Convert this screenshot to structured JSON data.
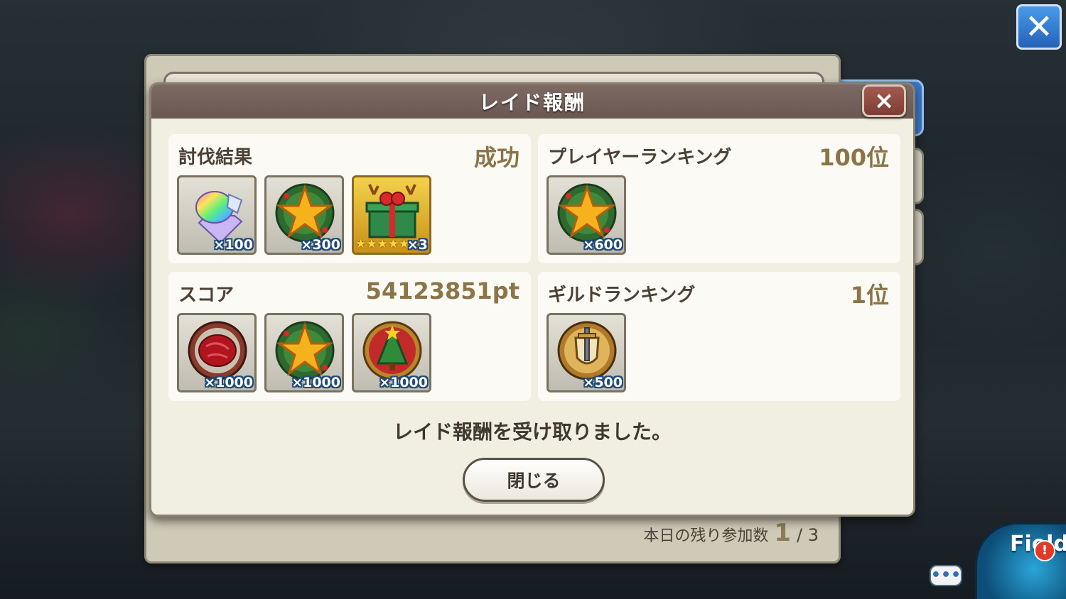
{
  "dialog": {
    "title": "レイド報酬",
    "close_icon": "×",
    "message": "レイド報酬を受け取りました。",
    "close_label": "閉じる"
  },
  "sections": {
    "result": {
      "label": "討伐結果",
      "value": "成功",
      "items": [
        {
          "icon": "rainbow-crystal-icon",
          "qty": "×100"
        },
        {
          "icon": "star-wreath-icon",
          "qty": "×300"
        },
        {
          "icon": "present-box-icon",
          "qty": "×3",
          "stars": "★★★★★"
        }
      ]
    },
    "player_ranking": {
      "label": "プレイヤーランキング",
      "value": "100位",
      "items": [
        {
          "icon": "star-wreath-icon",
          "qty": "×600"
        }
      ]
    },
    "score": {
      "label": "スコア",
      "value": "54123851pt",
      "items": [
        {
          "icon": "red-meat-medal-icon",
          "qty": "×1000"
        },
        {
          "icon": "star-wreath-icon",
          "qty": "×1000"
        },
        {
          "icon": "christmas-tree-medal-icon",
          "qty": "×1000"
        }
      ]
    },
    "guild_ranking": {
      "label": "ギルドランキング",
      "value": "1位",
      "items": [
        {
          "icon": "gold-shield-medal-icon",
          "qty": "×500"
        }
      ]
    }
  },
  "background": {
    "remaining_label": "本日の残り参加数",
    "remaining_current": "1",
    "remaining_total": "/ 3",
    "top_close_icon": "✕",
    "chat_icon": "•••",
    "field_label": "Field",
    "field_alert": "!"
  }
}
